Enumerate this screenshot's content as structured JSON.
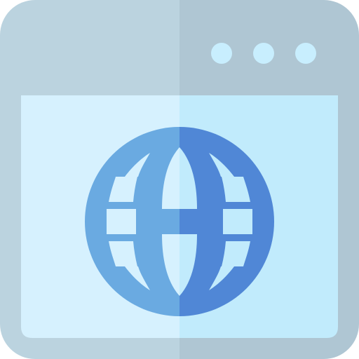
{
  "icon": {
    "name": "browser-window-globe-icon",
    "parts": [
      "window-frame",
      "title-bar",
      "window-controls",
      "content-pane",
      "globe-icon"
    ]
  },
  "window_controls": {
    "count": 3,
    "icons": [
      "dot-icon",
      "dot-icon",
      "dot-icon"
    ]
  },
  "colors": {
    "frame_left": "#BBD3DF",
    "frame_right": "#AFC6D3",
    "pane_left": "#D6F1FE",
    "pane_right": "#C1EBFC",
    "dot": "#C8EEFE",
    "globe_left": "#6AAAE1",
    "globe_right": "#5087D6"
  }
}
